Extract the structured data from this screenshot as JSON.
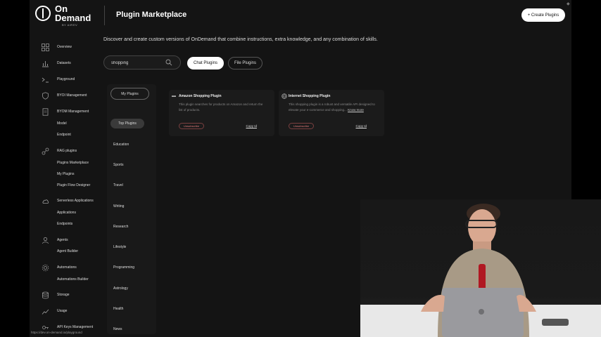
{
  "header": {
    "logo_text": "On Demand",
    "logo_sub": "BY AIREV",
    "title": "Plugin Marketplace",
    "create_button": "+ Create Plugins"
  },
  "sidebar": {
    "items": [
      {
        "label": "Overview",
        "icon": "grid-icon"
      },
      {
        "label": "Datasets",
        "icon": "bar-chart-icon"
      },
      {
        "label": "Playground",
        "icon": "terminal-icon"
      },
      {
        "label": "BYOI Management",
        "icon": "shield-icon"
      },
      {
        "label": "BYOM Management",
        "icon": "document-icon"
      },
      {
        "label": "RAG plugins",
        "icon": "link-icon"
      },
      {
        "label": "Serverless Applications",
        "icon": "cloud-icon"
      },
      {
        "label": "Agents",
        "icon": "user-icon"
      },
      {
        "label": "Automations",
        "icon": "gear-icon"
      },
      {
        "label": "Storage",
        "icon": "database-icon"
      },
      {
        "label": "Usage",
        "icon": "line-chart-icon"
      },
      {
        "label": "API Keys Management",
        "icon": "key-icon"
      }
    ],
    "sub": {
      "model": "Model",
      "endpoint": "Endpoint",
      "plugins_marketplace": "Plugins Marketplace",
      "my_plugins": "My Plugins",
      "plugin_flow_designer": "Plugin Flow Designer",
      "applications": "Applications",
      "endpoints": "Endpoints",
      "agent_builder": "Agent Builder",
      "automations_builder": "Automations Builder"
    }
  },
  "main": {
    "intro": "Discover and create custom versions of OnDemand that combine instructions, extra knowledge, and any combination of skills.",
    "search_value": "shopping",
    "tabs": [
      {
        "label": "Chat Plugins",
        "active": true
      },
      {
        "label": "File Plugins",
        "active": false
      }
    ],
    "my_plugins_label": "My Plugins",
    "categories": [
      "Top Plugins",
      "Education",
      "Sports",
      "Travel",
      "Writing",
      "Research",
      "Lifestyle",
      "Programming",
      "Astrology",
      "Health",
      "News"
    ],
    "active_category": "Top Plugins",
    "cards": [
      {
        "title": "Amazon Shopping Plugin",
        "description": "This plugin searches for products on Amazon and return the list of products.",
        "know_more": "",
        "unsubscribe": "Unsubscribe",
        "copy": "Copy Id"
      },
      {
        "title": "Internet Shopping Plugin",
        "description": "This shopping plugin is a robust and versatile API designed to elevate your e-commerce and shopping...",
        "know_more": "Know more",
        "unsubscribe": "Unsubscribe",
        "copy": "Copy Id"
      }
    ]
  },
  "status_url": "https://dev.on-demand.io/playground",
  "colors": {
    "background": "#141414",
    "panel": "#1b1b1b",
    "accent_button": "#ffffff",
    "unsubscribe": "#d77777"
  }
}
